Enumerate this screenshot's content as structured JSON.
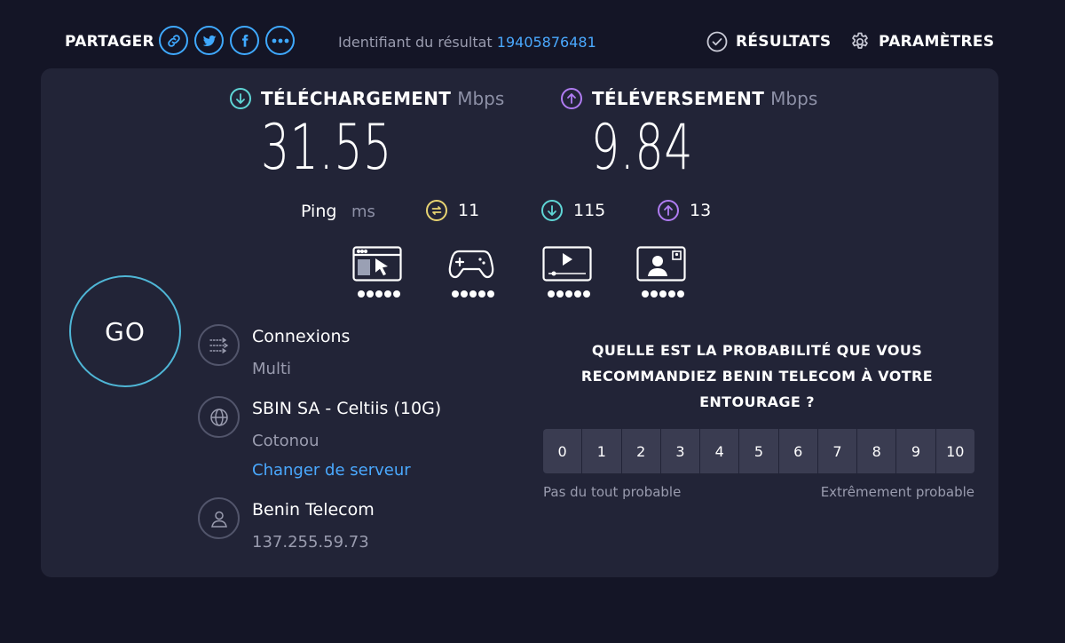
{
  "header": {
    "share_label": "PARTAGER",
    "share_buttons": [
      "link-icon",
      "twitter-icon",
      "facebook-icon",
      "more-icon"
    ],
    "result_id_label": "Identifiant du résultat",
    "result_id_value": "19405876481",
    "results_label": "RÉSULTATS",
    "settings_label": "PARAMÈTRES"
  },
  "download": {
    "title": "TÉLÉCHARGEMENT",
    "unit": "Mbps",
    "value": "31.55"
  },
  "upload": {
    "title": "TÉLÉVERSEMENT",
    "unit": "Mbps",
    "value": "9.84"
  },
  "ping": {
    "label": "Ping",
    "unit": "ms",
    "idle": "11",
    "download": "115",
    "upload": "13"
  },
  "quality": [
    {
      "icon": "web-browsing-icon",
      "rating": 5,
      "max": 5
    },
    {
      "icon": "gaming-icon",
      "rating": 5,
      "max": 5
    },
    {
      "icon": "video-streaming-icon",
      "rating": 5,
      "max": 5
    },
    {
      "icon": "video-call-icon",
      "rating": 5,
      "max": 5
    }
  ],
  "go_label": "GO",
  "connections": {
    "title": "Connexions",
    "value": "Multi"
  },
  "server": {
    "title": "SBIN SA - Celtiis (10G)",
    "location": "Cotonou",
    "change_link": "Changer de serveur"
  },
  "provider": {
    "title": "Benin Telecom",
    "ip": "137.255.59.73"
  },
  "survey": {
    "question_line1": "QUELLE EST LA PROBABILITÉ QUE VOUS",
    "question_line2": "RECOMMANDIEZ BENIN TELECOM À VOTRE",
    "question_line3": "ENTOURAGE ?",
    "options": [
      "0",
      "1",
      "2",
      "3",
      "4",
      "5",
      "6",
      "7",
      "8",
      "9",
      "10"
    ],
    "low_label": "Pas du tout probable",
    "high_label": "Extrêmement probable"
  },
  "colors": {
    "background": "#141526",
    "panel": "#222437",
    "accent_blue": "#4aa9ff",
    "download": "#5fd6d6",
    "upload": "#b07cf2",
    "ping_idle": "#e8d472"
  }
}
